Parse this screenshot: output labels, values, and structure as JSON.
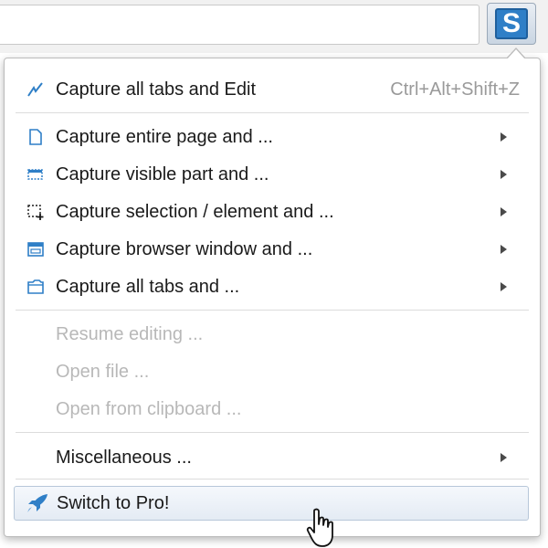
{
  "extension": {
    "logo_letter": "S"
  },
  "menu": {
    "top_item": {
      "label": "Capture all tabs and Edit",
      "shortcut": "Ctrl+Alt+Shift+Z",
      "icon": "pen-icon"
    },
    "capture_items": [
      {
        "label": "Capture entire page and ...",
        "icon": "page-icon"
      },
      {
        "label": "Capture visible part and ...",
        "icon": "visible-part-icon"
      },
      {
        "label": "Capture selection / element and ...",
        "icon": "selection-icon"
      },
      {
        "label": "Capture browser window and ...",
        "icon": "browser-window-icon"
      },
      {
        "label": "Capture all tabs and ...",
        "icon": "tabs-icon"
      }
    ],
    "disabled_items": [
      {
        "label": "Resume editing ..."
      },
      {
        "label": "Open file ..."
      },
      {
        "label": "Open from clipboard ..."
      }
    ],
    "misc_item": {
      "label": "Miscellaneous ..."
    },
    "pro_button": {
      "label": "Switch to Pro!",
      "icon": "rocket-icon"
    }
  },
  "colors": {
    "accent": "#2f7fc7",
    "disabled_text": "#b8b8b8",
    "shortcut_text": "#9a9a9a"
  }
}
